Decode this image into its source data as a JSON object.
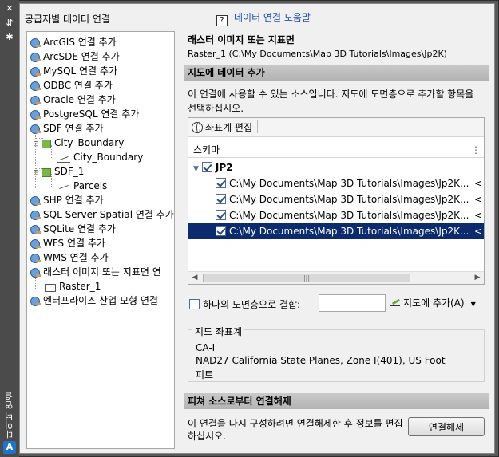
{
  "side_strip": {
    "close_glyph": "✕",
    "pin_glyph": "⇵",
    "settings_glyph": "✱",
    "title": "데이터 연결",
    "logo_glyph": "A"
  },
  "left": {
    "title": "공급자별 데이터 연결",
    "tree": [
      {
        "label": "ArcGIS 연결 추가",
        "icon": "plug-icon"
      },
      {
        "label": "ArcSDE 연결 추가",
        "icon": "plug-icon"
      },
      {
        "label": "MySQL 연결 추가",
        "icon": "plug-icon"
      },
      {
        "label": "ODBC 연결 추가",
        "icon": "plug-icon"
      },
      {
        "label": "Oracle 연결 추가",
        "icon": "plug-icon"
      },
      {
        "label": "PostgreSQL 연결 추가",
        "icon": "plug-icon"
      },
      {
        "label": "SDF 연결 추가",
        "icon": "plug-icon"
      },
      {
        "label": "City_Boundary",
        "icon": "layer-icon"
      },
      {
        "label": "City_Boundary",
        "icon": "feature-icon"
      },
      {
        "label": "SDF_1",
        "icon": "layer-icon"
      },
      {
        "label": "Parcels",
        "icon": "feature-icon"
      },
      {
        "label": "SHP 연결 추가",
        "icon": "plug-icon"
      },
      {
        "label": "SQL Server Spatial 연결 추가",
        "icon": "plug-icon"
      },
      {
        "label": "SQLite 연결 추가",
        "icon": "plug-icon"
      },
      {
        "label": "WFS 연결 추가",
        "icon": "plug-icon"
      },
      {
        "label": "WMS 연결 추가",
        "icon": "plug-icon"
      },
      {
        "label": "래스터 이미지 또는 지표면 연",
        "icon": "plug-icon"
      },
      {
        "label": "Raster_1",
        "icon": "raster-icon"
      },
      {
        "label": "엔터프라이즈 산업 모형 연결",
        "icon": "plug-icon"
      }
    ]
  },
  "right": {
    "help_glyph": "?",
    "help_link": "데이터 연결 도움말",
    "section_title": "래스터 이미지 또는 지표면",
    "section_subtitle": "Raster_1 (C:\\My Documents\\Map 3D Tutorials\\Images\\Jp2K)",
    "add_bar": "지도에 데이터 추가",
    "add_desc": "이 연결에 사용할 수 있는 소스입니다. 지도에 도면층으로 추가할 항목을 선택하십시오.",
    "toolbar_label": "좌표계 편집",
    "grid_header": "스키마",
    "schema_group": "JP2",
    "rows": [
      {
        "path": "C:\\My Documents\\Map 3D Tutorials\\Images\\Jp2K...",
        "trail": "<",
        "checked": true,
        "selected": false
      },
      {
        "path": "C:\\My Documents\\Map 3D Tutorials\\Images\\Jp2K...",
        "trail": "<",
        "checked": true,
        "selected": false
      },
      {
        "path": "C:\\My Documents\\Map 3D Tutorials\\Images\\Jp2K...",
        "trail": "<",
        "checked": true,
        "selected": false
      },
      {
        "path": "C:\\My Documents\\Map 3D Tutorials\\Images\\Jp2K...",
        "trail": "<",
        "checked": true,
        "selected": true
      }
    ],
    "combine_label": "하나의 도면층으로 결합:",
    "combine_value": "",
    "add_button": "지도에 추가(A)",
    "coord_legend": "지도 좌표계",
    "coord_lines": [
      "CA-I",
      "NAD27 California State Planes, Zone I(401), US Foot",
      "피트"
    ],
    "disconnect_bar": "피쳐 소스로부터 연결해제",
    "disconnect_desc": "이 연결을 다시 구성하려면 연결해제한 후 정보를 편집하십시오.",
    "disconnect_button": "연결해제"
  }
}
